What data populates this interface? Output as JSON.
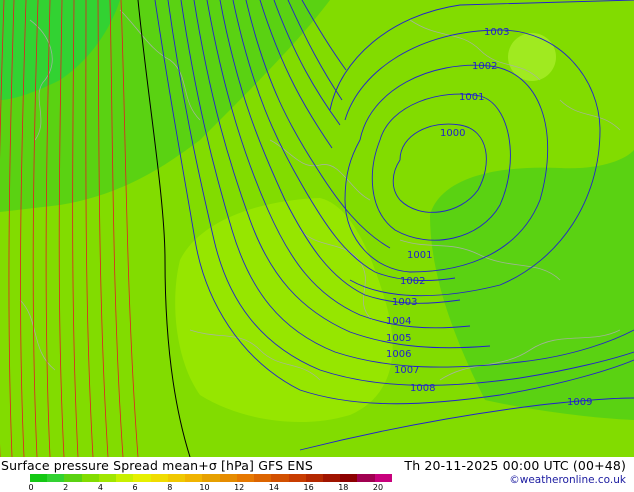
{
  "title": "Surface pressure Spread mean+σ [hPa] GFS ENS",
  "valid_time": "Th 20-11-2025 00:00 UTC (00+48)",
  "credit": "©weatheronline.co.uk",
  "colorbar": {
    "ticks": [
      "0",
      "2",
      "4",
      "6",
      "8",
      "10",
      "12",
      "14",
      "16",
      "18",
      "20"
    ],
    "colors": [
      "#14c814",
      "#32d232",
      "#5ad212",
      "#82dc00",
      "#a0e600",
      "#c8f000",
      "#e6f000",
      "#f0dc00",
      "#f0c800",
      "#f0b400",
      "#e6a000",
      "#e68c00",
      "#e67800",
      "#dc6400",
      "#d25000",
      "#c83c00",
      "#b42800",
      "#a01400",
      "#8c0000",
      "#a00050",
      "#c8007c"
    ]
  },
  "isobars": [
    {
      "label": "1000"
    },
    {
      "label": "1001"
    },
    {
      "label": "1001"
    },
    {
      "label": "1002"
    },
    {
      "label": "1002"
    },
    {
      "label": "1003"
    },
    {
      "label": "1003"
    },
    {
      "label": "1004"
    },
    {
      "label": "1005"
    },
    {
      "label": "1006"
    },
    {
      "label": "1007"
    },
    {
      "label": "1008"
    },
    {
      "label": "1009"
    }
  ]
}
